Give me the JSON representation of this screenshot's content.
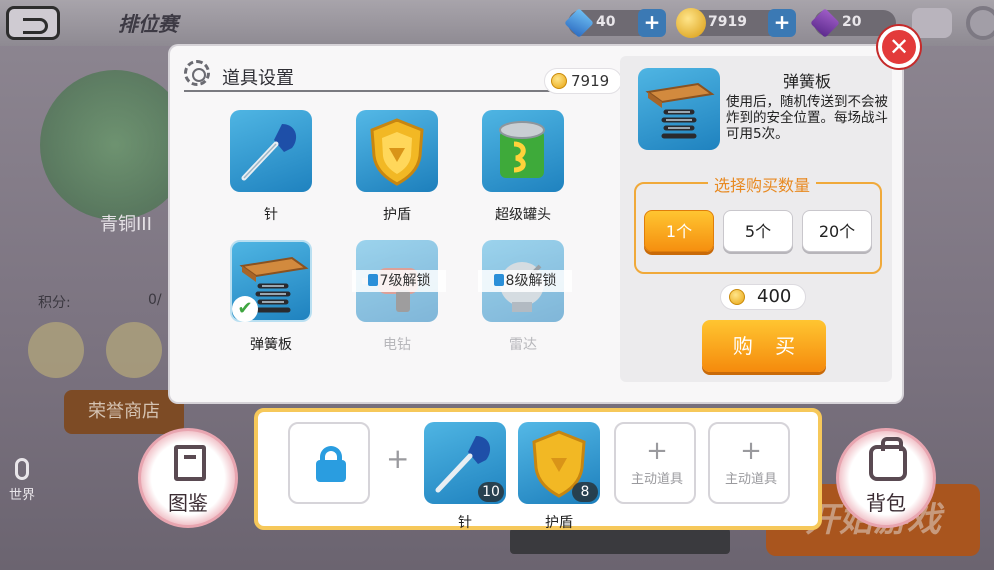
{
  "topbar": {
    "title": "排位赛",
    "gems": "40",
    "gold": "7919",
    "crystals": "20"
  },
  "lobby": {
    "rank_name": "青铜III",
    "score_label": "积分:",
    "score_value": "0/",
    "honor_shop": "荣誉商店",
    "world_chat": "世界",
    "start_game": "开始游戏"
  },
  "dialog": {
    "title": "道具设置",
    "coins": "7919",
    "items": [
      {
        "name": "针",
        "state": "available"
      },
      {
        "name": "护盾",
        "state": "available"
      },
      {
        "name": "超级罐头",
        "state": "available"
      },
      {
        "name": "弹簧板",
        "state": "selected"
      },
      {
        "name": "电钻",
        "state": "locked",
        "lock_text": "7级解锁"
      },
      {
        "name": "雷达",
        "state": "locked",
        "lock_text": "8级解锁"
      }
    ],
    "detail": {
      "title": "弹簧板",
      "description": "使用后，随机传送到不会被炸到的安全位置。每场战斗可用5次。",
      "qty_label": "选择购买数量",
      "qty_options": [
        "1个",
        "5个",
        "20个"
      ],
      "selected_qty": "1个",
      "price": "400",
      "buy_label": "购 买"
    }
  },
  "loadout": {
    "slots": [
      {
        "type": "locked"
      },
      {
        "type": "item",
        "name": "针",
        "count": "10"
      },
      {
        "type": "item",
        "name": "护盾",
        "count": "8"
      },
      {
        "type": "empty",
        "label": "主动道具"
      },
      {
        "type": "empty",
        "label": "主动道具"
      }
    ]
  },
  "side_buttons": {
    "gallery": "图鉴",
    "backpack": "背包"
  },
  "colors": {
    "accent_orange": "#f58f0f",
    "close_red": "#e33a3a",
    "tile_blue": "#1f82bf",
    "loadout_border": "#f6c85a"
  }
}
